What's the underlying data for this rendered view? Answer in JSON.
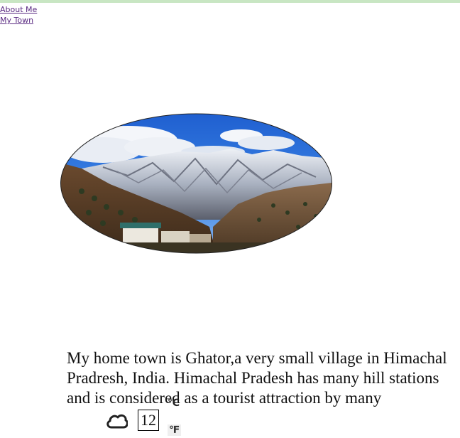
{
  "nav": {
    "links": [
      {
        "label": "About Me"
      },
      {
        "label": "My Town"
      }
    ]
  },
  "main": {
    "photo": {
      "description_icon": "mountain-town-photo"
    },
    "paragraph": "My home town is Ghator,a very small village in Himachal Pradresh, India. Himachal Pradesh has many hill stations and is considered as a tourist attraction by many"
  },
  "weather": {
    "icon": "cloud-icon",
    "temperature": "12",
    "unit_celsius": "℃",
    "unit_fahrenheit": "℉"
  },
  "colors": {
    "top_border": "#c8e6c3",
    "link": "#5a2a82",
    "sky": "#2a6fd6"
  }
}
